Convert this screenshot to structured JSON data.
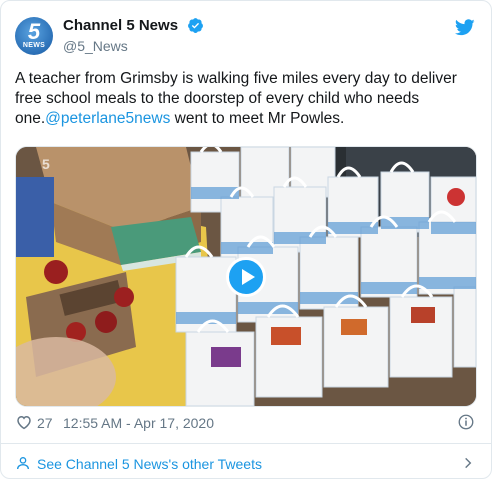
{
  "author": {
    "display_name": "Channel 5 News",
    "handle": "@5_News",
    "avatar_number": "5",
    "avatar_caption": "NEWS"
  },
  "tweet": {
    "text_before": "A teacher from Grimsby is walking five miles every day to deliver free school meals to the doorstep of every child who needs one.",
    "mention": "@peterlane5news",
    "text_after": " went to meet Mr Powles."
  },
  "meta": {
    "likes": "27",
    "timestamp": "12:55 AM - Apr 17, 2020"
  },
  "footer": {
    "label": "See Channel 5 News's other Tweets"
  },
  "icons": {
    "verified": "verified-badge-icon",
    "bird": "twitter-bird-icon",
    "heart": "heart-icon",
    "info": "info-icon",
    "person": "person-icon",
    "chevron": "chevron-right-icon",
    "play": "play-icon"
  },
  "colors": {
    "accent": "#1da1f2",
    "link": "#1b95e0",
    "muted": "#657786"
  }
}
